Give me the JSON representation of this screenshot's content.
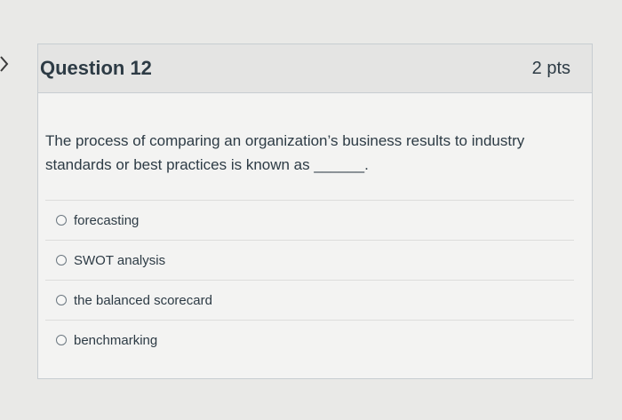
{
  "question": {
    "title": "Question 12",
    "points": "2 pts",
    "text": "The process of comparing an organization’s business results to industry standards or best practices is known as ______."
  },
  "answers": [
    {
      "label": "forecasting"
    },
    {
      "label": "SWOT analysis"
    },
    {
      "label": "the balanced scorecard"
    },
    {
      "label": "benchmarking"
    }
  ],
  "icons": {
    "left_nav": "chevron-right-icon",
    "choice": "radio-button-icon"
  },
  "colors": {
    "background": "#e9e9e7",
    "card": "#f3f3f2",
    "header": "#e4e4e3",
    "text": "#2d3b45",
    "border": "#c7cdd1"
  }
}
